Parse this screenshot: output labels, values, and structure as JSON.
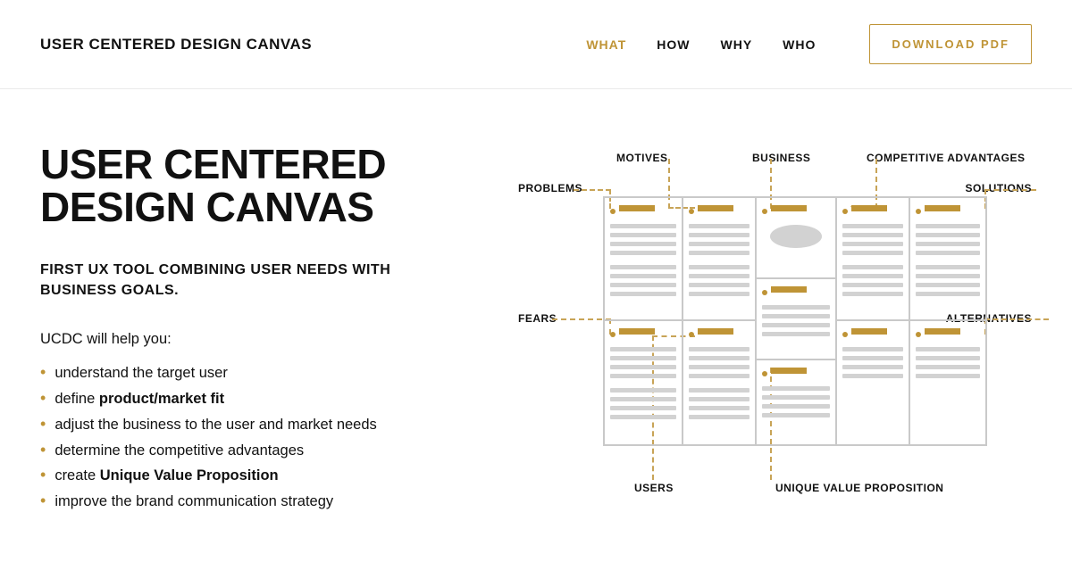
{
  "header": {
    "logo": "USER CENTERED DESIGN CANVAS",
    "nav": {
      "what": "WHAT",
      "how": "HOW",
      "why": "WHY",
      "who": "WHO"
    },
    "download": "DOWNLOAD  PDF"
  },
  "hero": {
    "title_line1": "USER CENTERED",
    "title_line2": "DESIGN CANVAS",
    "tagline": "FIRST UX TOOL COMBINING USER NEEDS WITH BUSINESS GOALS.",
    "intro": "UCDC will help you:",
    "benefits": [
      {
        "pre": "understand the target user",
        "bold": "",
        "post": ""
      },
      {
        "pre": "define ",
        "bold": "product/market fit",
        "post": ""
      },
      {
        "pre": "adjust the business to the user and market needs",
        "bold": "",
        "post": ""
      },
      {
        "pre": "determine the competitive advantages",
        "bold": "",
        "post": ""
      },
      {
        "pre": "create ",
        "bold": "Unique Value Proposition",
        "post": ""
      },
      {
        "pre": "improve the brand communication strategy",
        "bold": "",
        "post": ""
      }
    ]
  },
  "diagram": {
    "labels": {
      "problems": "PROBLEMS",
      "motives": "MOTIVES",
      "business": "BUSINESS",
      "advantages": "COMPETITIVE ADVANTAGES",
      "solutions": "SOLUTIONS",
      "fears": "FEARS",
      "alternatives": "ALTERNATIVES",
      "users": "USERS",
      "uvp": "UNIQUE VALUE PROPOSITION"
    }
  },
  "colors": {
    "accent": "#bf9436"
  }
}
